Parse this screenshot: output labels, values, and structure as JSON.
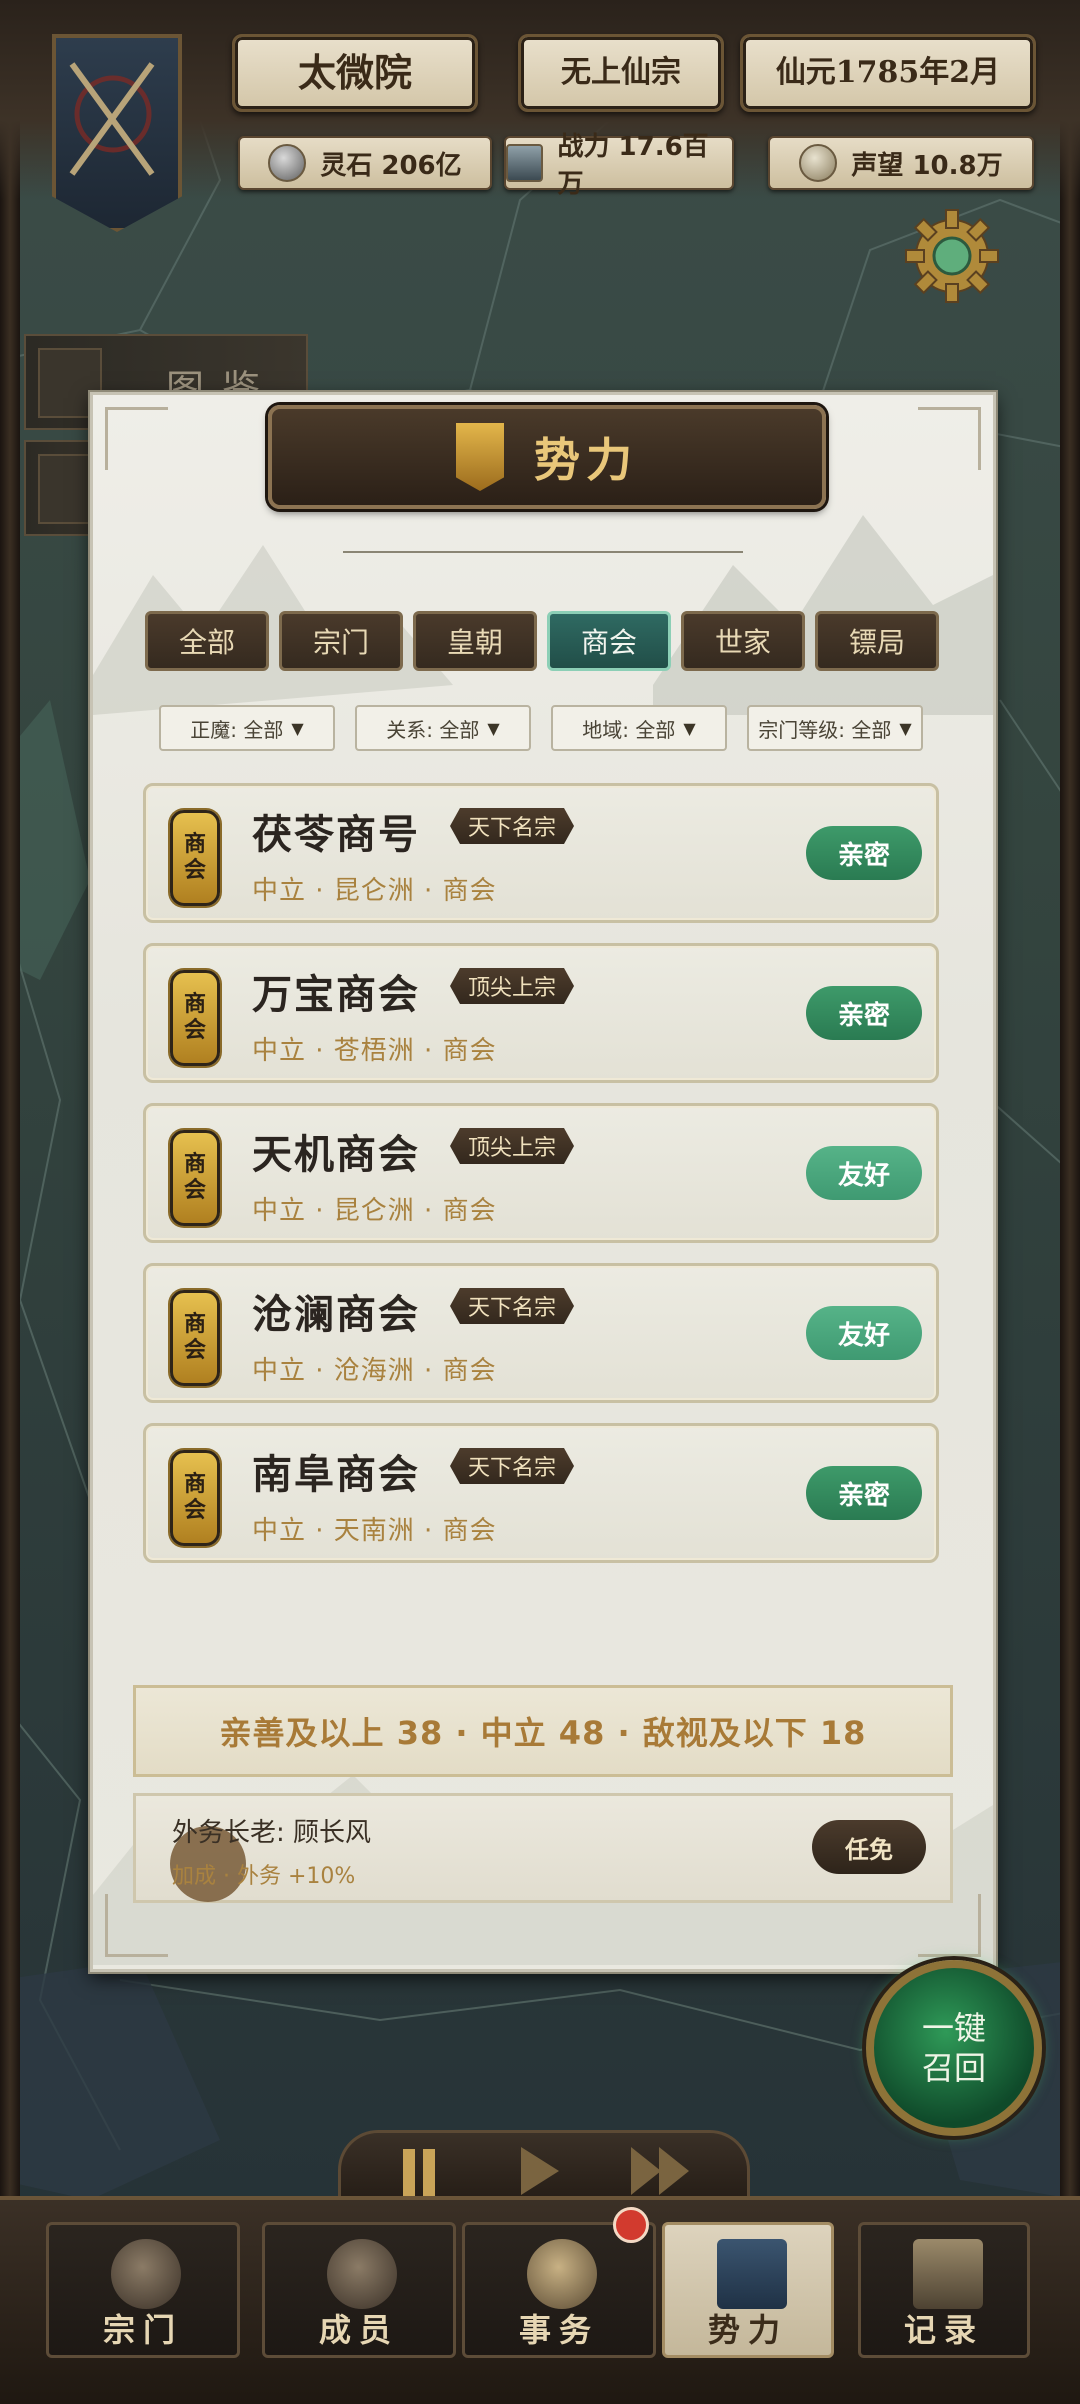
{
  "header": {
    "sect_name": "太微院",
    "sect_title": "无上仙宗",
    "date": "仙元1785年2月",
    "stats": [
      {
        "icon": "spirit-stone-icon",
        "text": "灵石 206亿"
      },
      {
        "icon": "power-trident-icon",
        "text": "战力 17.6百万"
      },
      {
        "icon": "reputation-orb-icon",
        "text": "声望 10.8万"
      }
    ]
  },
  "side_tabs": [
    "图鉴"
  ],
  "panel": {
    "title": "势力",
    "tabs": [
      "全部",
      "宗门",
      "皇朝",
      "商会",
      "世家",
      "镖局"
    ],
    "active_tab": "商会",
    "filters": [
      {
        "label": "正魔: 全部"
      },
      {
        "label": "关系: 全部"
      },
      {
        "label": "地域: 全部"
      },
      {
        "label": "宗门等级: 全部"
      }
    ],
    "factions": [
      {
        "seal": [
          "商",
          "会"
        ],
        "name": "茯苓商号",
        "rank": "天下名宗",
        "meta": "中立 · 昆仑洲 · 商会",
        "relation": "亲密"
      },
      {
        "seal": [
          "商",
          "会"
        ],
        "name": "万宝商会",
        "rank": "顶尖上宗",
        "meta": "中立 · 苍梧洲 · 商会",
        "relation": "亲密"
      },
      {
        "seal": [
          "商",
          "会"
        ],
        "name": "天机商会",
        "rank": "顶尖上宗",
        "meta": "中立 · 昆仑洲 · 商会",
        "relation": "友好"
      },
      {
        "seal": [
          "商",
          "会"
        ],
        "name": "沧澜商会",
        "rank": "天下名宗",
        "meta": "中立 · 沧海洲 · 商会",
        "relation": "友好"
      },
      {
        "seal": [
          "商",
          "会"
        ],
        "name": "南阜商会",
        "rank": "天下名宗",
        "meta": "中立 · 天南洲 · 商会",
        "relation": "亲密"
      }
    ],
    "summary": "亲善及以上 38 · 中立 48 · 敌视及以下 18",
    "elder": {
      "label": "外务长老: 顾长风",
      "bonus": "加成 · 外务 +10%",
      "dismiss_label": "任免"
    }
  },
  "recall_button": {
    "line1": "一键",
    "line2": "召回"
  },
  "speed_controls": [
    "pause",
    "play",
    "fast-forward"
  ],
  "nav": [
    {
      "label": "宗门",
      "icon": "sect-gate-icon"
    },
    {
      "label": "成员",
      "icon": "member-portrait-icon"
    },
    {
      "label": "事务",
      "icon": "scroll-icon"
    },
    {
      "label": "势力",
      "icon": "faction-banner-icon"
    },
    {
      "label": "记录",
      "icon": "book-icon"
    }
  ],
  "active_nav": "势力",
  "colors": {
    "accent_gold": "#e9c77a",
    "active_tab": "#2f6a62",
    "relation_close": "#2a7b52",
    "relation_friend": "#56b388",
    "meta_text": "#a9823f"
  }
}
